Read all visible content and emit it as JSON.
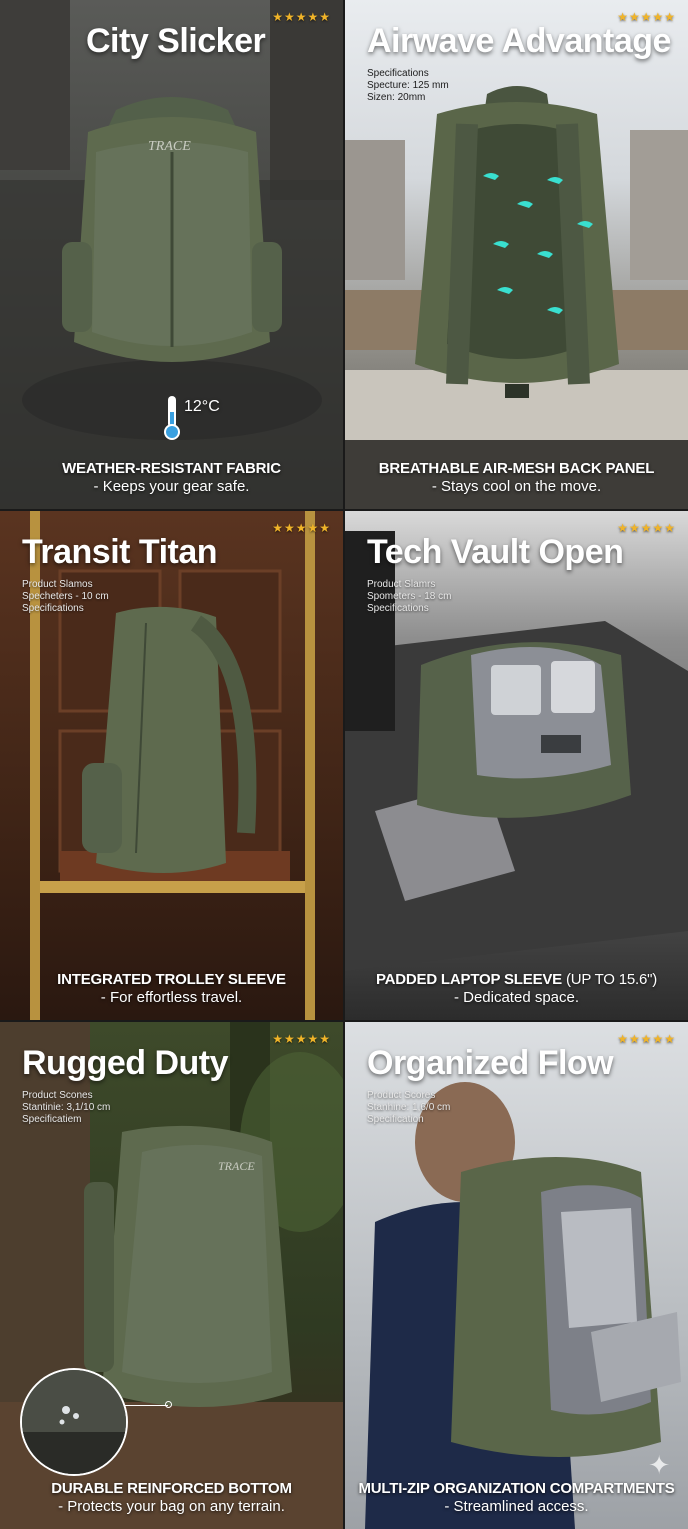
{
  "panels": [
    {
      "title": "City Slicker",
      "rating": "★★★★★",
      "temperature": "12°C",
      "feature_head": "WEATHER-RESISTANT FABRIC",
      "feature_sub": "- Keeps your gear safe.",
      "logo": "TRACE"
    },
    {
      "title": "Airwave Advantage",
      "rating": "★★★★★",
      "specs": [
        "Specifications",
        "Specture: 125 mm",
        "Sizen: 20mm"
      ],
      "feature_head": "BREATHABLE AIR-MESH BACK PANEL",
      "feature_sub": "- Stays cool on the move."
    },
    {
      "title": "Transit Titan",
      "rating": "★★★★★",
      "specs": [
        "Product Slamos",
        "Specheters - 10 cm",
        "Specifications"
      ],
      "feature_head": "INTEGRATED TROLLEY SLEEVE",
      "feature_sub": "- For effortless travel."
    },
    {
      "title": "Tech Vault Open",
      "rating": "★★★★★",
      "specs": [
        "Product Slamrs",
        "Spometers - 18 cm",
        "Specifications"
      ],
      "feature_head": "PADDED LAPTOP SLEEVE",
      "feature_head_extra": " (UP TO 15.6\")",
      "feature_sub": "- Dedicated space."
    },
    {
      "title": "Rugged Duty",
      "rating": "★★★★★",
      "specs": [
        "Product Scones",
        "Stantinie: 3,1/10 cm",
        "Specificatiem"
      ],
      "feature_head": "DURABLE REINFORCED BOTTOM",
      "feature_sub": "- Protects your bag on any terrain.",
      "logo": "TRACE"
    },
    {
      "title": "Organized Flow",
      "rating": "★★★★★",
      "specs": [
        "Product Scores",
        "Stanhine: 1,6/0 cm",
        "Specification"
      ],
      "feature_head": "MULTI-ZIP ORGANIZATION COMPARTMENTS",
      "feature_sub": "- Streamlined access."
    }
  ],
  "colors": {
    "accent_star": "#f0b429",
    "bag_green": "#5e6a4e",
    "mesh_arrow": "#39e0d0"
  },
  "icons": [
    "thermometer-icon",
    "star-rating-icon",
    "sparkle-icon",
    "airflow-icon"
  ]
}
